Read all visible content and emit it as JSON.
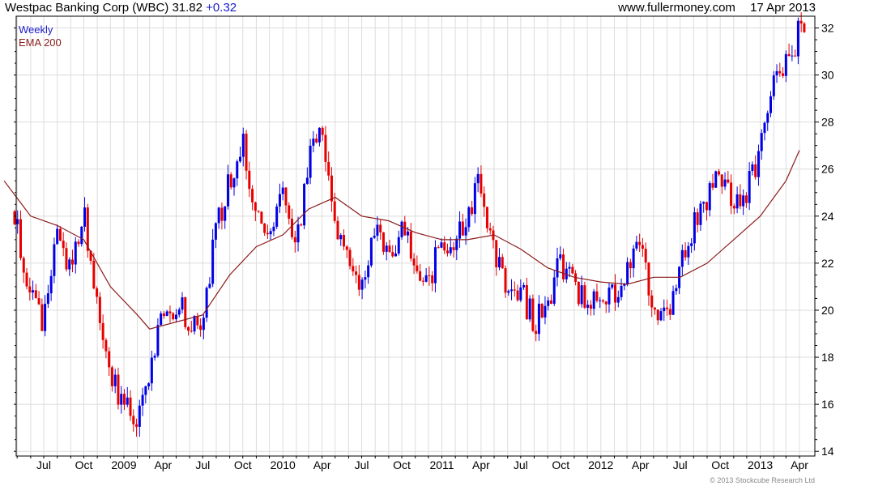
{
  "header": {
    "title": "Westpac Banking Corp (WBC) 31.82",
    "change": "+0.32",
    "website": "www.fullermoney.com",
    "date": "17 Apr 2013"
  },
  "legend": {
    "weekly": "Weekly",
    "ema": "EMA 200"
  },
  "copyright": "© 2013 Stockcube Research Ltd",
  "colors": {
    "up": "#0000e6",
    "down": "#e60000",
    "ema": "#8b1a1a",
    "grid": "#dcdcdc"
  },
  "chart_data": {
    "type": "candlestick",
    "title": "Westpac Banking Corp (WBC) 31.82 +0.32",
    "ylim": [
      13.8,
      32.5
    ],
    "y_ticks": [
      14,
      16,
      18,
      20,
      22,
      24,
      26,
      28,
      30,
      32
    ],
    "x_ticks": [
      {
        "label": "Jul",
        "date": "2008-07"
      },
      {
        "label": "Oct",
        "date": "2008-10"
      },
      {
        "label": "2009",
        "date": "2009-01"
      },
      {
        "label": "Apr",
        "date": "2009-04"
      },
      {
        "label": "Jul",
        "date": "2009-07"
      },
      {
        "label": "Oct",
        "date": "2009-10"
      },
      {
        "label": "2010",
        "date": "2010-01"
      },
      {
        "label": "Apr",
        "date": "2010-04"
      },
      {
        "label": "Jul",
        "date": "2010-07"
      },
      {
        "label": "Oct",
        "date": "2010-10"
      },
      {
        "label": "2011",
        "date": "2011-01"
      },
      {
        "label": "Apr",
        "date": "2011-04"
      },
      {
        "label": "Jul",
        "date": "2011-07"
      },
      {
        "label": "Oct",
        "date": "2011-10"
      },
      {
        "label": "2012",
        "date": "2012-01"
      },
      {
        "label": "Apr",
        "date": "2012-04"
      },
      {
        "label": "Jul",
        "date": "2012-07"
      },
      {
        "label": "Oct",
        "date": "2012-10"
      },
      {
        "label": "2013",
        "date": "2013-01"
      },
      {
        "label": "Apr",
        "date": "2013-04"
      }
    ],
    "close_path": [
      [
        "2008-04",
        26.0
      ],
      [
        "2008-05",
        23.5
      ],
      [
        "2008-06",
        20.8
      ],
      [
        "2008-07",
        19.5
      ],
      [
        "2008-08",
        23.5
      ],
      [
        "2008-09",
        21.8
      ],
      [
        "2008-10",
        24.0
      ],
      [
        "2008-11",
        20.5
      ],
      [
        "2008-12",
        17.0
      ],
      [
        "2009-01",
        16.2
      ],
      [
        "2009-02",
        15.2
      ],
      [
        "2009-03",
        17.0
      ],
      [
        "2009-04",
        20.0
      ],
      [
        "2009-05",
        20.3
      ],
      [
        "2009-06",
        19.5
      ],
      [
        "2009-07",
        19.8
      ],
      [
        "2009-08",
        23.5
      ],
      [
        "2009-09",
        25.5
      ],
      [
        "2009-10",
        27.0
      ],
      [
        "2009-11",
        24.0
      ],
      [
        "2009-12",
        23.0
      ],
      [
        "2010-01",
        25.5
      ],
      [
        "2010-02",
        22.8
      ],
      [
        "2010-03",
        26.5
      ],
      [
        "2010-04",
        28.0
      ],
      [
        "2010-05",
        23.5
      ],
      [
        "2010-06",
        22.0
      ],
      [
        "2010-07",
        21.3
      ],
      [
        "2010-08",
        23.5
      ],
      [
        "2010-09",
        22.0
      ],
      [
        "2010-10",
        23.5
      ],
      [
        "2010-11",
        22.0
      ],
      [
        "2010-12",
        21.0
      ],
      [
        "2011-01",
        23.0
      ],
      [
        "2011-02",
        23.0
      ],
      [
        "2011-03",
        24.0
      ],
      [
        "2011-04",
        25.5
      ],
      [
        "2011-05",
        22.5
      ],
      [
        "2011-06",
        21.0
      ],
      [
        "2011-07",
        20.8
      ],
      [
        "2011-08",
        19.5
      ],
      [
        "2011-09",
        20.5
      ],
      [
        "2011-10",
        22.0
      ],
      [
        "2011-11",
        21.0
      ],
      [
        "2011-12",
        20.3
      ],
      [
        "2012-01",
        20.8
      ],
      [
        "2012-02",
        20.6
      ],
      [
        "2012-03",
        21.8
      ],
      [
        "2012-04",
        22.5
      ],
      [
        "2012-05",
        20.2
      ],
      [
        "2012-06",
        20.0
      ],
      [
        "2012-07",
        21.8
      ],
      [
        "2012-08",
        23.5
      ],
      [
        "2012-09",
        24.8
      ],
      [
        "2012-10",
        25.5
      ],
      [
        "2012-11",
        24.5
      ],
      [
        "2012-12",
        25.2
      ],
      [
        "2013-01",
        26.5
      ],
      [
        "2013-02",
        30.5
      ],
      [
        "2013-03",
        30.3
      ],
      [
        "2013-04",
        31.82
      ]
    ],
    "ema_200": [
      [
        "2008-04",
        25.5
      ],
      [
        "2008-06",
        24.0
      ],
      [
        "2008-08",
        23.6
      ],
      [
        "2008-10",
        23.0
      ],
      [
        "2008-12",
        21.0
      ],
      [
        "2009-02",
        19.8
      ],
      [
        "2009-03",
        19.2
      ],
      [
        "2009-05",
        19.5
      ],
      [
        "2009-07",
        19.8
      ],
      [
        "2009-09",
        21.5
      ],
      [
        "2009-11",
        22.7
      ],
      [
        "2010-01",
        23.2
      ],
      [
        "2010-03",
        24.3
      ],
      [
        "2010-05",
        24.8
      ],
      [
        "2010-07",
        24.0
      ],
      [
        "2010-09",
        23.8
      ],
      [
        "2010-11",
        23.3
      ],
      [
        "2011-01",
        23.0
      ],
      [
        "2011-03",
        23.0
      ],
      [
        "2011-05",
        23.2
      ],
      [
        "2011-07",
        22.6
      ],
      [
        "2011-09",
        21.8
      ],
      [
        "2011-11",
        21.4
      ],
      [
        "2012-01",
        21.2
      ],
      [
        "2012-03",
        21.1
      ],
      [
        "2012-05",
        21.4
      ],
      [
        "2012-07",
        21.4
      ],
      [
        "2012-09",
        22.0
      ],
      [
        "2012-11",
        23.0
      ],
      [
        "2013-01",
        24.0
      ],
      [
        "2013-03",
        25.5
      ],
      [
        "2013-04",
        26.8
      ]
    ]
  }
}
